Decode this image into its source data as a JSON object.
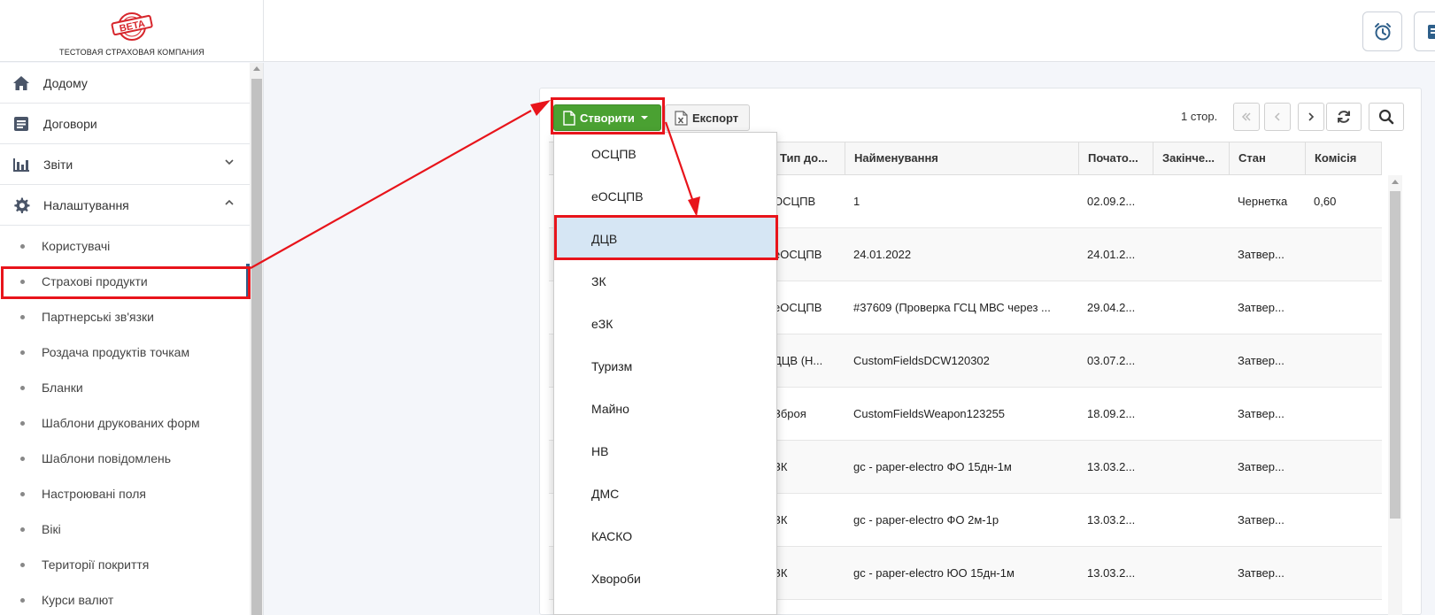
{
  "header": {
    "logo_text": "BETA",
    "company_name": "ТЕСТОВАЯ СТРАХОВАЯ КОМПАНИЯ",
    "buttons": [
      {
        "icon": "alarm-clock-icon"
      },
      {
        "icon": "document-icon"
      }
    ]
  },
  "sidebar": {
    "items": [
      {
        "label": "Додому",
        "icon": "home-icon"
      },
      {
        "label": "Договори",
        "icon": "contracts-icon"
      },
      {
        "label": "Звіти",
        "icon": "bar-chart-icon",
        "expanded": false
      },
      {
        "label": "Налаштування",
        "icon": "gear-icon",
        "expanded": true
      }
    ],
    "subitems": [
      {
        "label": "Користувачі"
      },
      {
        "label": "Страхові продукти"
      },
      {
        "label": "Партнерські зв'язки"
      },
      {
        "label": "Роздача продуктів точкам"
      },
      {
        "label": "Бланки"
      },
      {
        "label": "Шаблони друкованих форм"
      },
      {
        "label": "Шаблони повідомлень"
      },
      {
        "label": "Настроювані поля"
      },
      {
        "label": "Вікі"
      },
      {
        "label": "Території покриття"
      },
      {
        "label": "Курси валют"
      }
    ],
    "active_subitem": "Страхові продукти"
  },
  "toolbar": {
    "create_label": "Створити",
    "export_label": "Експорт",
    "pages_label": "1 стор."
  },
  "dropdown": {
    "items": [
      "ОСЦПВ",
      "еОСЦПВ",
      "ДЦВ",
      "ЗК",
      "еЗК",
      "Туризм",
      "Майно",
      "НВ",
      "ДМС",
      "КАСКО",
      "Хвороби"
    ],
    "hovered": "ДЦВ"
  },
  "table": {
    "columns": [
      "Тип до...",
      "Найменування",
      "Почато...",
      "Закінче...",
      "Стан",
      "Комісія"
    ],
    "rows": [
      [
        "ОСЦПВ",
        "1",
        "02.09.2...",
        "",
        "Чернетка",
        "0,60"
      ],
      [
        "еОСЦПВ",
        "24.01.2022",
        "24.01.2...",
        "",
        "Затвер...",
        ""
      ],
      [
        "еОСЦПВ",
        "#37609 (Проверка ГСЦ МВС через ...",
        "29.04.2...",
        "",
        "Затвер...",
        ""
      ],
      [
        "ДЦВ (Н...",
        "CustomFieldsDCW120302",
        "03.07.2...",
        "",
        "Затвер...",
        ""
      ],
      [
        "Зброя",
        "CustomFieldsWeapon123255",
        "18.09.2...",
        "",
        "Затвер...",
        ""
      ],
      [
        "ЗК",
        "gc - paper-electro ФО 15дн-1м",
        "13.03.2...",
        "",
        "Затвер...",
        ""
      ],
      [
        "ЗК",
        "gc - paper-electro ФО 2м-1р",
        "13.03.2...",
        "",
        "Затвер...",
        ""
      ],
      [
        "ЗК",
        "gc - paper-electro ЮО 15дн-1м",
        "13.03.2...",
        "",
        "Затвер...",
        ""
      ]
    ]
  },
  "colors": {
    "create_green": "#4aa132",
    "highlight_red": "#e8141b",
    "hover_blue": "#d6e6f4",
    "brand_dark": "#2e5f8a"
  }
}
